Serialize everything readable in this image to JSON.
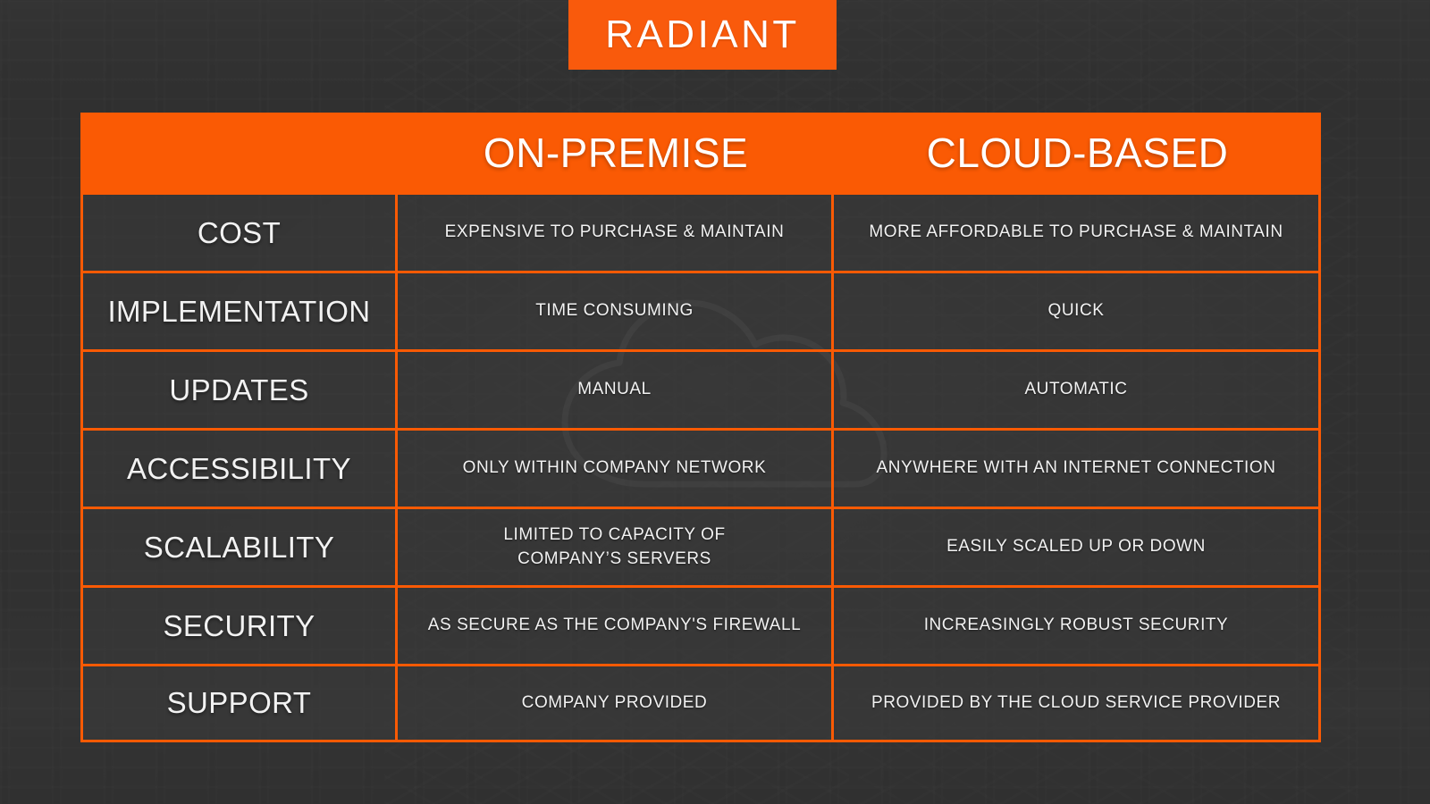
{
  "brand": {
    "logo_text": "RADIANT",
    "accent_color": "#FA5A04",
    "banner_color": "#F95A0C",
    "cell_background_color": "#3B3B3B",
    "text_color": "#FFFFFF"
  },
  "background": {
    "watermark_icon": "cloud-icon",
    "scene": "server-room-photo"
  },
  "table": {
    "headers": {
      "label_column": "",
      "column_1": "ON-PREMISE",
      "column_2": "CLOUD-BASED"
    },
    "rows": [
      {
        "label": "COST",
        "on_premise": "EXPENSIVE TO PURCHASE & MAINTAIN",
        "cloud_based": "MORE AFFORDABLE TO PURCHASE & MAINTAIN"
      },
      {
        "label": "IMPLEMENTATION",
        "on_premise": "TIME CONSUMING",
        "cloud_based": "QUICK"
      },
      {
        "label": "UPDATES",
        "on_premise": "MANUAL",
        "cloud_based": "AUTOMATIC"
      },
      {
        "label": "ACCESSIBILITY",
        "on_premise": "ONLY  WITHIN COMPANY NETWORK",
        "cloud_based": "ANYWHERE WITH AN INTERNET CONNECTION"
      },
      {
        "label": "SCALABILITY",
        "on_premise_line_1": "LIMITED TO CAPACITY OF",
        "on_premise_line_2": "COMPANY’S SERVERS",
        "cloud_based": "EASILY SCALED UP OR DOWN"
      },
      {
        "label": "SECURITY",
        "on_premise": "AS SECURE AS THE COMPANY'S FIREWALL",
        "cloud_based": "INCREASINGLY ROBUST SECURITY"
      },
      {
        "label": "SUPPORT",
        "on_premise": "COMPANY PROVIDED",
        "cloud_based": "PROVIDED BY THE CLOUD SERVICE PROVIDER"
      }
    ]
  }
}
